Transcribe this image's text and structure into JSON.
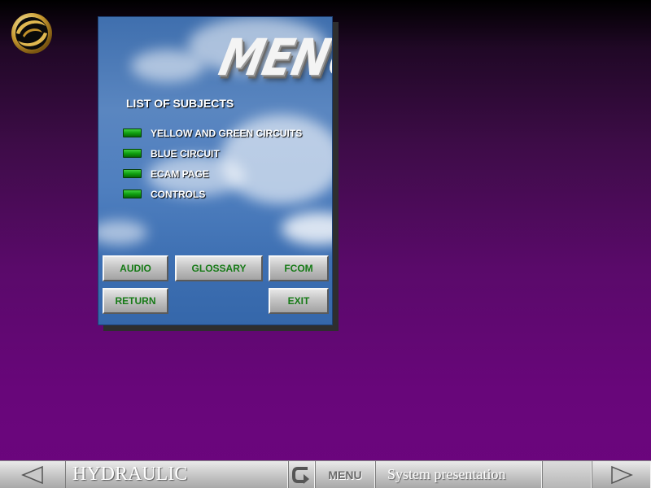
{
  "icons": {
    "logo": "airline-logo-icon",
    "prev": "left-arrow-icon",
    "back": "return-arrow-icon",
    "next": "right-arrow-icon"
  },
  "colors": {
    "led_green": "#10a010",
    "button_text_green": "#167a16",
    "background_purple": "#6c057e"
  },
  "menu_panel": {
    "title": "MENU",
    "list_title": "LIST OF SUBJECTS",
    "subjects": [
      {
        "label": "YELLOW AND GREEN CIRCUITS"
      },
      {
        "label": "BLUE CIRCUIT"
      },
      {
        "label": "ECAM PAGE"
      },
      {
        "label": "CONTROLS"
      }
    ],
    "buttons": {
      "audio": "AUDIO",
      "glossary": "GLOSSARY",
      "fcom": "FCOM",
      "return": "RETURN",
      "exit": "EXIT"
    }
  },
  "bottom_bar": {
    "module_title": "HYDRAULIC",
    "menu_label": "MENU",
    "section_title": "System presentation"
  }
}
